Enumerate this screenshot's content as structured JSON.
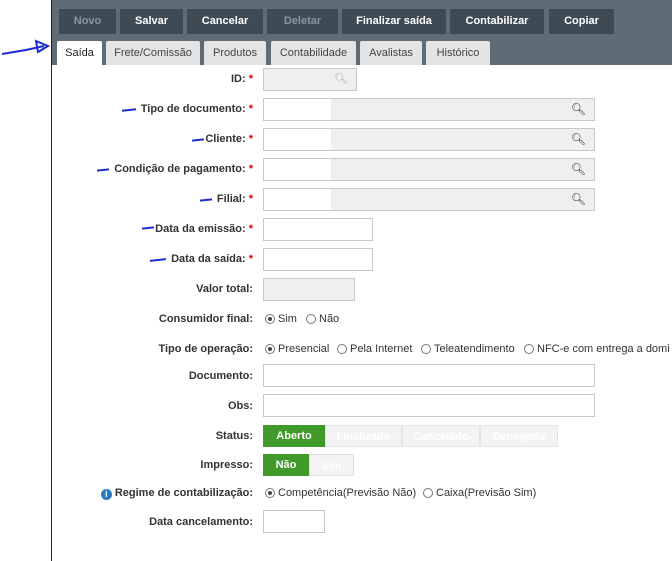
{
  "toolbar": {
    "buttons": [
      "Novo",
      "Salvar",
      "Cancelar",
      "Deletar",
      "Finalizar saída",
      "Contabilizar",
      "Copiar"
    ]
  },
  "tabs": [
    "Saída",
    "Frete/Comissão",
    "Produtos",
    "Contabilidade",
    "Avalistas",
    "Histórico"
  ],
  "form": {
    "id_label": "ID:",
    "tipo_documento_label": "Tipo de documento:",
    "cliente_label": "Cliente:",
    "condicao_pagamento_label": "Condição de pagamento:",
    "filial_label": "Filial:",
    "data_emissao_label": "Data da emissão:",
    "data_saida_label": "Data da saída:",
    "valor_total_label": "Valor total:",
    "consumidor_final_label": "Consumidor final:",
    "consumidor_options": [
      "Sim",
      "Não"
    ],
    "consumidor_selected": "Sim",
    "tipo_operacao_label": "Tipo de operação:",
    "tipo_operacao_options": [
      "Presencial",
      "Pela Internet",
      "Teleatendimento",
      "NFC-e com entrega a domi"
    ],
    "tipo_operacao_selected": "Presencial",
    "documento_label": "Documento:",
    "obs_label": "Obs:",
    "status_label": "Status:",
    "status_options": [
      "Aberto",
      "Finalizado",
      "Cancelado",
      "Denegada"
    ],
    "status_selected": "Aberto",
    "impresso_label": "Impresso:",
    "impresso_options": [
      "Não",
      "Sim"
    ],
    "impresso_selected": "Não",
    "regime_label": "Regime de contabilização:",
    "regime_options": [
      "Competência(Previsão Não)",
      "Caixa(Previsão Sim)"
    ],
    "regime_selected": "Competência(Previsão Não)",
    "data_cancelamento_label": "Data cancelamento:",
    "required_mark": "*"
  },
  "colors": {
    "toolbar_bg": "#5f6b75",
    "button_bg": "#3e4a54",
    "active_green": "#3f9a2a",
    "required_red": "#dd0000",
    "annotation_blue": "#1c2cd0"
  }
}
